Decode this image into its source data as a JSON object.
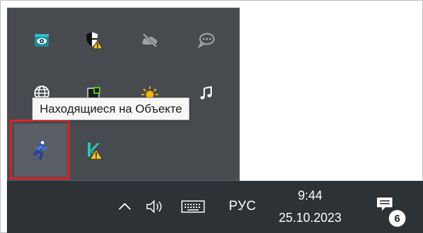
{
  "tooltip": {
    "text": "Находящиеся на Объекте"
  },
  "tray_icons": [
    {
      "name": "eye-app-icon"
    },
    {
      "name": "security-shield-warning-icon"
    },
    {
      "name": "onedrive-offline-icon"
    },
    {
      "name": "chat-bubble-icon"
    },
    {
      "name": "network-globe-icon"
    },
    {
      "name": "app-window-icon"
    },
    {
      "name": "weather-sun-icon"
    },
    {
      "name": "music-note-icon"
    },
    {
      "name": "running-person-icon"
    },
    {
      "name": "k-app-warning-icon"
    }
  ],
  "taskbar": {
    "language": "РУС",
    "time": "9:44",
    "date": "25.10.2023",
    "notification_count": "6"
  },
  "colors": {
    "taskbar": "#2d3236",
    "tray_popup": "#474b50",
    "highlight": "#e01f26",
    "accent_cyan": "#29b6c8",
    "warning": "#f5c518"
  }
}
